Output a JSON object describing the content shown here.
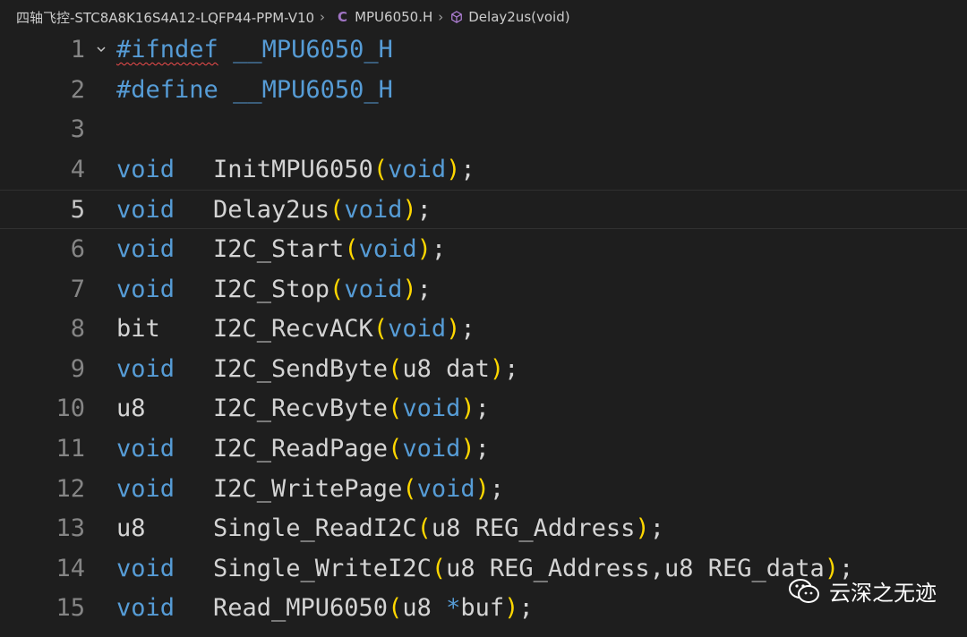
{
  "breadcrumb": {
    "project": "四轴飞控-STC8A8K16S4A12-LQFP44-PPM-V10",
    "file_icon": "C",
    "file": "MPU6050.H",
    "symbol": "Delay2us(void)"
  },
  "editor": {
    "current_line": 5,
    "lines": [
      {
        "n": "1",
        "type": "pp",
        "directive": "#ifndef",
        "name": "__MPU6050_H"
      },
      {
        "n": "2",
        "type": "pp",
        "directive": "#define",
        "name": "__MPU6050_H"
      },
      {
        "n": "3",
        "type": "blank"
      },
      {
        "n": "4",
        "type": "decl",
        "ret": "void",
        "fn": "InitMPU6050",
        "args": "void"
      },
      {
        "n": "5",
        "type": "decl",
        "ret": "void",
        "fn": "Delay2us",
        "args": "void"
      },
      {
        "n": "6",
        "type": "decl",
        "ret": "void",
        "fn": "I2C_Start",
        "args": "void"
      },
      {
        "n": "7",
        "type": "decl",
        "ret": "void",
        "fn": "I2C_Stop",
        "args": "void"
      },
      {
        "n": "8",
        "type": "decl",
        "ret": "bit",
        "fn": "I2C_RecvACK",
        "args": "void"
      },
      {
        "n": "9",
        "type": "decl",
        "ret": "void",
        "fn": "I2C_SendByte",
        "args": "u8 dat"
      },
      {
        "n": "10",
        "type": "decl",
        "ret": "u8",
        "fn": "I2C_RecvByte",
        "args": "void"
      },
      {
        "n": "11",
        "type": "decl",
        "ret": "void",
        "fn": "I2C_ReadPage",
        "args": "void"
      },
      {
        "n": "12",
        "type": "decl",
        "ret": "void",
        "fn": "I2C_WritePage",
        "args": "void"
      },
      {
        "n": "13",
        "type": "decl",
        "ret": "u8",
        "fn": "Single_ReadI2C",
        "args": "u8 REG_Address"
      },
      {
        "n": "14",
        "type": "decl",
        "ret": "void",
        "fn": "Single_WriteI2C",
        "args": "u8 REG_Address,u8 REG_data"
      },
      {
        "n": "15",
        "type": "decl",
        "ret": "void",
        "fn": "Read_MPU6050",
        "args": "u8 *buf"
      }
    ]
  },
  "watermark": {
    "text": "云深之无迹"
  },
  "colors": {
    "keyword": "#569cd6",
    "bracket": "#ffd700",
    "text": "#d4d4d4",
    "line_number": "#858585",
    "background": "#1e1e1e"
  }
}
